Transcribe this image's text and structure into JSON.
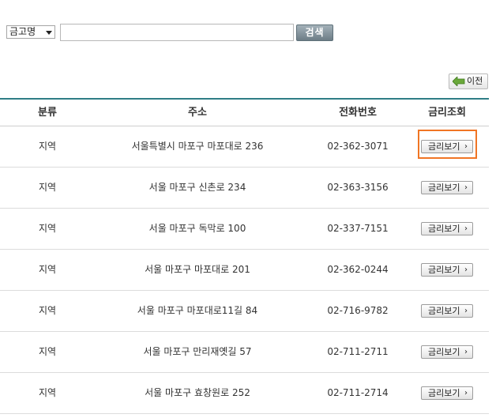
{
  "search": {
    "select_value": "금고명",
    "input_value": "",
    "button_label": "검색"
  },
  "prev_button": {
    "label": "이전"
  },
  "table": {
    "headers": [
      "분류",
      "주소",
      "전화번호",
      "금리조회"
    ],
    "rows": [
      {
        "category": "지역",
        "address": "서울특별시 마포구 마포대로 236",
        "phone": "02-362-3071",
        "button": "금리보기"
      },
      {
        "category": "지역",
        "address": "서울 마포구 신촌로 234",
        "phone": "02-363-3156",
        "button": "금리보기"
      },
      {
        "category": "지역",
        "address": "서울 마포구 독막로 100",
        "phone": "02-337-7151",
        "button": "금리보기"
      },
      {
        "category": "지역",
        "address": "서울 마포구 마포대로 201",
        "phone": "02-362-0244",
        "button": "금리보기"
      },
      {
        "category": "지역",
        "address": "서울 마포구 마포대로11길 84",
        "phone": "02-716-9782",
        "button": "금리보기"
      },
      {
        "category": "지역",
        "address": "서울 마포구 만리재옛길 57",
        "phone": "02-711-2711",
        "button": "금리보기"
      },
      {
        "category": "지역",
        "address": "서울 마포구 효창원로 252",
        "phone": "02-711-2714",
        "button": "금리보기"
      }
    ]
  },
  "colors": {
    "table_top_border": "#2f7d86",
    "highlight": "#f07524",
    "search_button": "#7e8d96"
  }
}
